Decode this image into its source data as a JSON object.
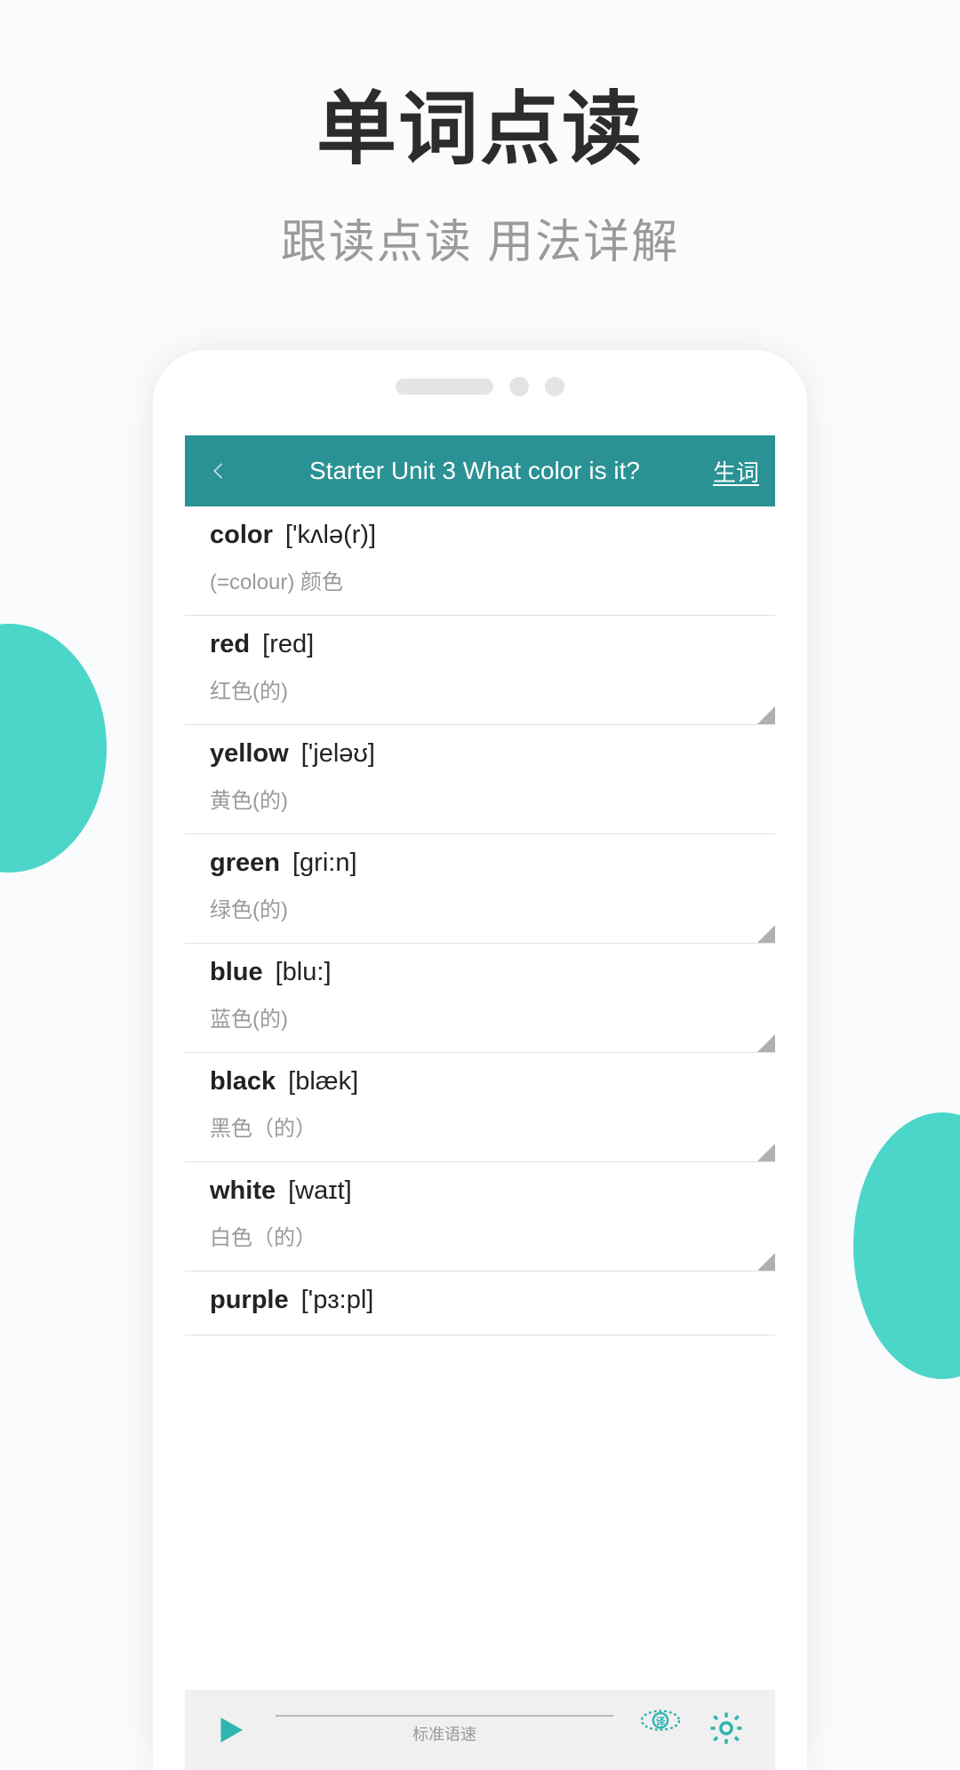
{
  "hero": {
    "title": "单词点读",
    "subtitle": "跟读点读 用法详解"
  },
  "header": {
    "title": "Starter Unit 3 What color is it?",
    "action": "生词"
  },
  "words": [
    {
      "term": "color",
      "phonetic": "['kʌlə(r)]",
      "definition": "(=colour) 颜色",
      "triangle": false
    },
    {
      "term": "red",
      "phonetic": "[red]",
      "definition": "红色(的)",
      "triangle": true
    },
    {
      "term": "yellow",
      "phonetic": "['jeləʊ]",
      "definition": "黄色(的)",
      "triangle": false
    },
    {
      "term": "green",
      "phonetic": "[gri:n]",
      "definition": "绿色(的)",
      "triangle": true
    },
    {
      "term": "blue",
      "phonetic": "[blu:]",
      "definition": "蓝色(的)",
      "triangle": true
    },
    {
      "term": "black",
      "phonetic": "[blæk]",
      "definition": "黑色（的）",
      "triangle": true
    },
    {
      "term": "white",
      "phonetic": "[waɪt]",
      "definition": "白色（的）",
      "triangle": true
    },
    {
      "term": "purple",
      "phonetic": "['pɜ:pl]",
      "definition": "",
      "triangle": false
    }
  ],
  "bottomBar": {
    "speedLabel": "标准语速",
    "accentColor": "#2eb5b0"
  }
}
